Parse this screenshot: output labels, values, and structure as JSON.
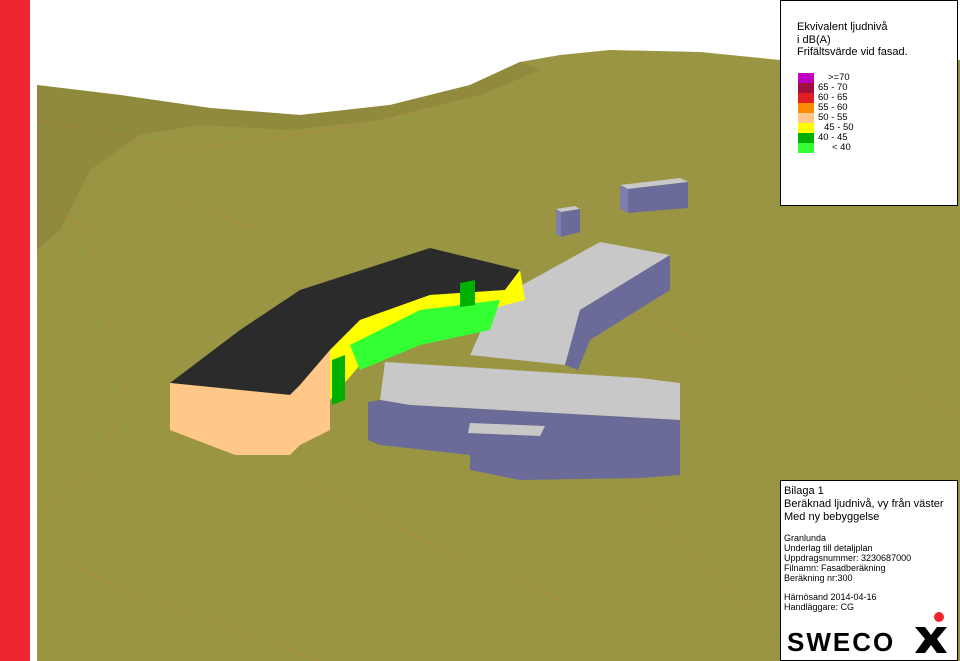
{
  "colors": {
    "stripe": "#ee2630",
    "terrain": "#9a9543",
    "building_new_facade": "#ffc888",
    "building_new_roof": "#2b2b2b",
    "building_existing_wall": "#6b6b99",
    "building_existing_roof": "#c8c8c8"
  },
  "legend": {
    "title_lines": [
      "Ekvivalent ljudnivå",
      "i dB(A)",
      "Frifältsvärde vid fasad."
    ],
    "items": [
      {
        "label": ">=70",
        "color": "#c000c0"
      },
      {
        "label": "65  -  70",
        "color": "#a0103a"
      },
      {
        "label": "60  -  65",
        "color": "#e02020"
      },
      {
        "label": "55  -  60",
        "color": "#ff8c00"
      },
      {
        "label": "50  -  55",
        "color": "#ffc888"
      },
      {
        "label": "45  -  50",
        "color": "#ffff00"
      },
      {
        "label": "40  -  45",
        "color": "#00b000"
      },
      {
        "label": "< 40",
        "color": "#33ff33"
      }
    ]
  },
  "info": {
    "bilaga": "Bilaga 1",
    "description": "Beräknad ljudnivå, vy från väster",
    "subtitle": "Med ny bebyggelse",
    "project": "Granlunda",
    "purpose": "Underlag till detaljplan",
    "assignment": "Uppdragsnummer: 3230687000",
    "filename": "Filnamn: Fasadberäkning",
    "calc": "Beräkning nr:300",
    "place_date": "Härnösand 2014-04-16",
    "handler": "Handläggare: CG"
  },
  "logo": {
    "text": "SWECO"
  }
}
